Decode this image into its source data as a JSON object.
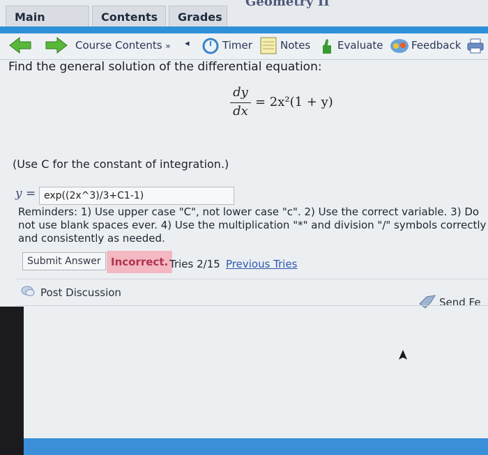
{
  "header": {
    "site_title": "Geometry II",
    "tabs": [
      {
        "label": "Main Menu"
      },
      {
        "label": "Contents"
      },
      {
        "label": "Grades"
      }
    ]
  },
  "nav": {
    "course_contents": "Course Contents",
    "course_contents_chevron": "»",
    "left_marker": "◂",
    "timer": "Timer",
    "notes": "Notes",
    "evaluate": "Evaluate",
    "feedback": "Feedback"
  },
  "problem": {
    "prompt": "Find the general solution of the differential equation:",
    "equation": {
      "numerator": "dy",
      "denominator": "dx",
      "rhs": "= 2x²(1 + y)"
    },
    "note": "(Use C for the constant of integration.)"
  },
  "answer": {
    "label": "y =",
    "value": "exp((2x^3)/3+C1-1)"
  },
  "reminders": "Reminders: 1) Use upper case \"C\", not lower case \"c\". 2) Use the correct variable. 3) Do not use blank spaces ever. 4) Use the multiplication \"*\" and division \"/\" symbols correctly and consistently as needed.",
  "submission": {
    "submit_label": "Submit Answer",
    "status": "Incorrect.",
    "tries": "Tries 2/15",
    "previous_tries": "Previous Tries"
  },
  "discussion": {
    "post_label": "Post Discussion",
    "send_label": "Send Fe"
  },
  "colors": {
    "accent_blue": "#2e90d8",
    "incorrect_bg": "#f3b8c2",
    "incorrect_text": "#b0344c",
    "link": "#2b57b0"
  }
}
